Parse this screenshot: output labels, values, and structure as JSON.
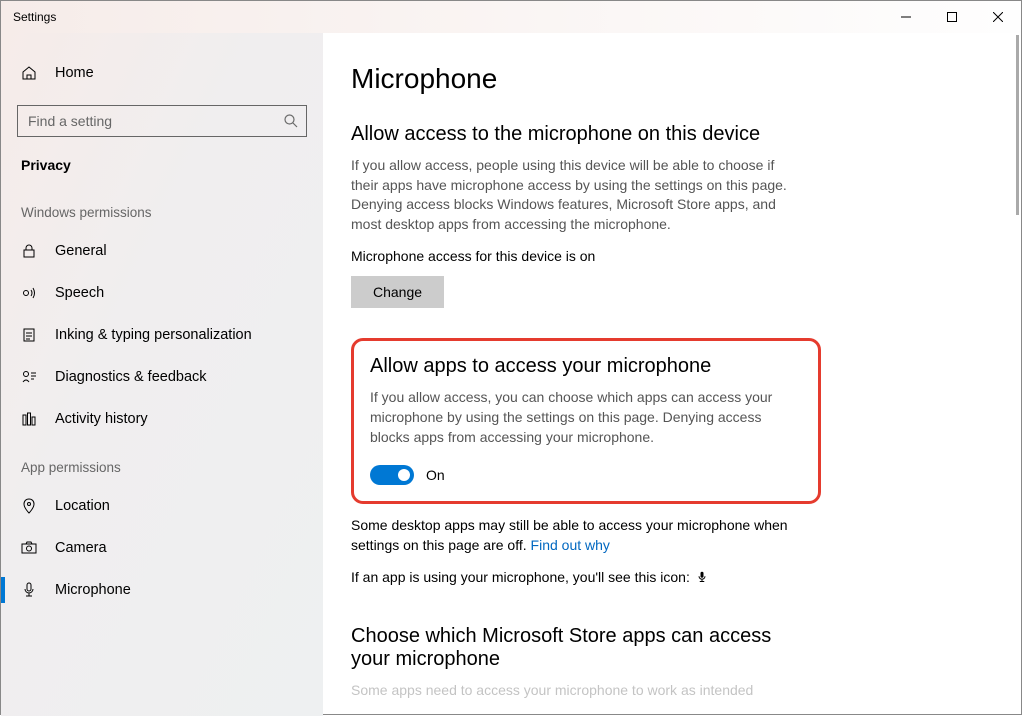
{
  "window": {
    "title": "Settings"
  },
  "sidebar": {
    "home": "Home",
    "search_placeholder": "Find a setting",
    "crumb": "Privacy",
    "section_windows": "Windows permissions",
    "section_app": "App permissions",
    "items_windows": [
      {
        "label": "General"
      },
      {
        "label": "Speech"
      },
      {
        "label": "Inking & typing personalization"
      },
      {
        "label": "Diagnostics & feedback"
      },
      {
        "label": "Activity history"
      }
    ],
    "items_app": [
      {
        "label": "Location"
      },
      {
        "label": "Camera"
      },
      {
        "label": "Microphone"
      }
    ]
  },
  "main": {
    "title": "Microphone",
    "s1_heading": "Allow access to the microphone on this device",
    "s1_body": "If you allow access, people using this device will be able to choose if their apps have microphone access by using the settings on this page. Denying access blocks Windows features, Microsoft Store apps, and most desktop apps from accessing the microphone.",
    "s1_status": "Microphone access for this device is on",
    "change": "Change",
    "s2_heading": "Allow apps to access your microphone",
    "s2_body": "If you allow access, you can choose which apps can access your microphone by using the settings on this page. Denying access blocks apps from accessing your microphone.",
    "toggle_label": "On",
    "desktop_note": "Some desktop apps may still be able to access your microphone when settings on this page are off. ",
    "find_out": "Find out why",
    "icon_note": "If an app is using your microphone, you'll see this icon:",
    "s3_heading": "Choose which Microsoft Store apps can access your microphone",
    "s3_body": "Some apps need to access your microphone to work as intended"
  }
}
